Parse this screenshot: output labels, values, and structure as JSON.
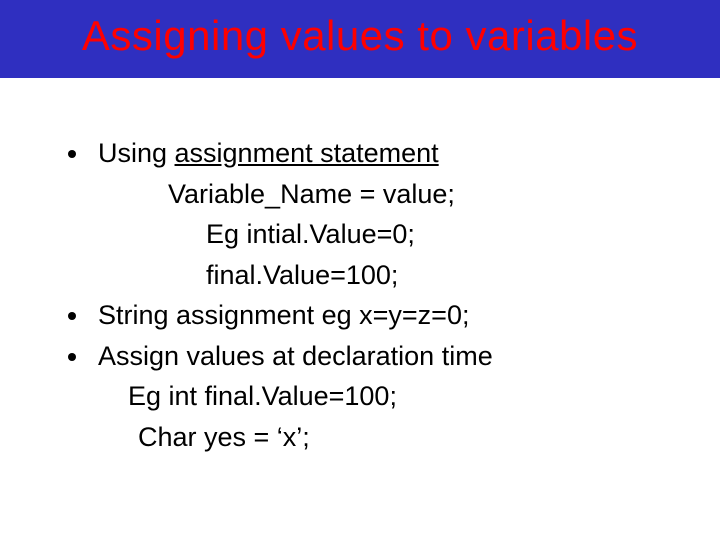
{
  "title": "Assigning values to variables",
  "bullets": [
    {
      "lead": "Using ",
      "underlined": "assignment statement",
      "sub": [
        {
          "cls": "indent1",
          "text": "Variable_Name = value;"
        },
        {
          "cls": "indent2",
          "text": "Eg intial.Value=0;"
        },
        {
          "cls": "indent2",
          "text": "final.Value=100;"
        }
      ]
    },
    {
      "lead": "String assignment   eg  x=y=z=0;",
      "sub": []
    },
    {
      "lead": "Assign values at declaration time",
      "sub": [
        {
          "cls": "indent0b",
          "text": "Eg  int final.Value=100;"
        },
        {
          "cls": "indent0c",
          "text": "Char yes = ‘x’;"
        }
      ]
    }
  ]
}
